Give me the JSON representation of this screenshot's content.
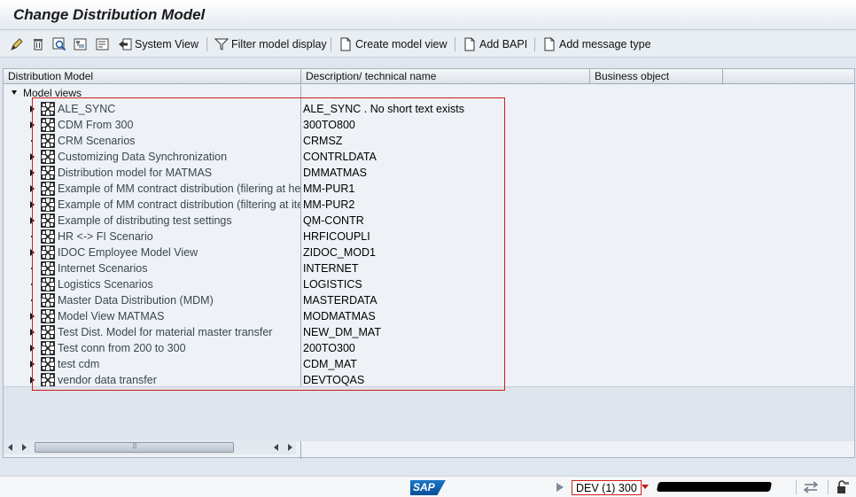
{
  "window": {
    "title": "Change Distribution Model"
  },
  "toolbar": {
    "icons": [
      "edit-icon",
      "delete-icon",
      "find-icon",
      "expand-icon",
      "collapse-icon"
    ],
    "system_view_label": "System View",
    "filter_label": "Filter model display",
    "create_view_label": "Create model view",
    "add_bapi_label": "Add BAPI",
    "add_message_type_label": "Add message type"
  },
  "grid": {
    "columns": [
      "Distribution Model",
      "Description/ technical name",
      "Business object"
    ],
    "root": {
      "label": "Model views",
      "expanded": true
    },
    "rows": [
      {
        "name": "ALE_SYNC",
        "tech": "ALE_SYNC  . No short text exists",
        "expandable": true
      },
      {
        "name": "CDM From 300",
        "tech": "300TO800",
        "expandable": true
      },
      {
        "name": "CRM Scenarios",
        "tech": "CRMSZ",
        "expandable": false
      },
      {
        "name": "Customizing Data Synchronization",
        "tech": "CONTRLDATA",
        "expandable": true
      },
      {
        "name": "Distribution model for MATMAS",
        "tech": "DMMATMAS",
        "expandable": true
      },
      {
        "name": "Example of MM contract distribution (filering at he",
        "tech": "MM-PUR1",
        "expandable": true
      },
      {
        "name": "Example of MM contract distribution (filtering at ite",
        "tech": "MM-PUR2",
        "expandable": true
      },
      {
        "name": "Example of distributing test settings",
        "tech": "QM-CONTR",
        "expandable": true
      },
      {
        "name": "HR <-> FI Scenario",
        "tech": "HRFICOUPLI",
        "expandable": false
      },
      {
        "name": "IDOC Employee Model View",
        "tech": "ZIDOC_MOD1",
        "expandable": true
      },
      {
        "name": "Internet Scenarios",
        "tech": "INTERNET",
        "expandable": false
      },
      {
        "name": "Logistics Scenarios",
        "tech": "LOGISTICS",
        "expandable": false
      },
      {
        "name": "Master Data Distribution (MDM)",
        "tech": "MASTERDATA",
        "expandable": false
      },
      {
        "name": "Model View MATMAS",
        "tech": "MODMATMAS",
        "expandable": true
      },
      {
        "name": "Test Dist. Model for material master transfer",
        "tech": "NEW_DM_MAT",
        "expandable": true
      },
      {
        "name": "Test conn from 200 to 300",
        "tech": "200TO300",
        "expandable": true
      },
      {
        "name": "test cdm",
        "tech": "CDM_MAT",
        "expandable": true
      },
      {
        "name": "vendor data transfer",
        "tech": "DEVTOQAS",
        "expandable": true
      }
    ]
  },
  "status": {
    "logo": "SAP",
    "system": "DEV (1) 300"
  },
  "colors": {
    "highlight": "#d11b1b",
    "sap_blue": "#0a5fae"
  }
}
